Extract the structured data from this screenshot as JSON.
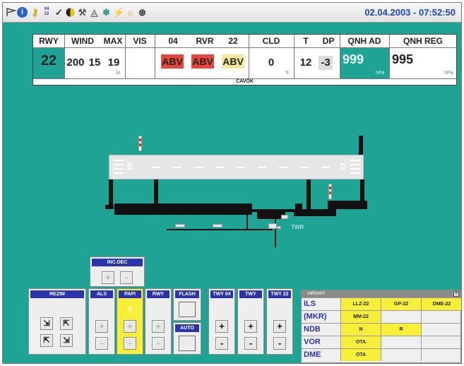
{
  "toolbar": {
    "datetime": "02.04.2003 - 07:52:50",
    "runway_pair_top": "04",
    "runway_pair_bottom": "22"
  },
  "weather": {
    "headers": {
      "rwy": "RWY",
      "wind": "WIND",
      "max": "MAX",
      "vis": "VIS",
      "rwy04": "04",
      "rvr": "RVR",
      "rwy22": "22",
      "cld": "CLD",
      "t": "T",
      "dp": "DP",
      "qnh_ad": "QNH AD",
      "qnh_reg": "QNH REG"
    },
    "rwy": "22",
    "wind_dir": "200",
    "wind_speed": "15",
    "wind_max": "19",
    "wind_unit": "kt",
    "rvr_04": "ABV",
    "rvr_mid": "ABV",
    "rvr_22": "ABV",
    "cld": "0",
    "cld_unit": "ft",
    "temp": "12",
    "dewpoint": "-3",
    "qnh_ad": "999",
    "qnh_ad_unit": "hPa",
    "qnh_reg": "995",
    "qnh_reg_unit": "hPa",
    "cavok": "CAVOK"
  },
  "map": {
    "rwy_num_left": "04",
    "rwy_num_right": "22",
    "twr_label": "TWR"
  },
  "panels": {
    "incdec": {
      "title": "INC.DEC",
      "plus": "+",
      "minus": "-"
    },
    "rezim": {
      "title": "REZIM"
    },
    "als": {
      "title": "ALS",
      "plus": "+",
      "minus": "-"
    },
    "papi": {
      "title": "PAPI",
      "value": "3",
      "plus": "+",
      "minus": "-"
    },
    "rwy": {
      "title": "RWY",
      "plus": "+",
      "minus": "-"
    },
    "flash": {
      "title": "FLASH"
    },
    "auto": {
      "title": "AUTO"
    },
    "twy04": {
      "title": "TWY 04",
      "plus": "+",
      "minus": "-"
    },
    "twy": {
      "title": "TWY",
      "plus": "+",
      "minus": "-"
    },
    "twy22": {
      "title": "TWY 22",
      "plus": "+",
      "minus": "-"
    }
  },
  "equipment": {
    "title": "zařízení",
    "rows": [
      {
        "label": "ILS",
        "cells": [
          "LLZ-22",
          "GP-22",
          "DME-22"
        ]
      },
      {
        "label": "(MKR)",
        "cells": [
          "MM-22",
          "",
          ""
        ]
      },
      {
        "label": "NDB",
        "cells": [
          "N",
          "R",
          ""
        ]
      },
      {
        "label": "VOR",
        "cells": [
          "OTA",
          "",
          ""
        ]
      },
      {
        "label": "DME",
        "cells": [
          "OTA",
          "",
          ""
        ]
      }
    ]
  },
  "colors": {
    "background": "#1fa394",
    "title_bar": "#2b34a8",
    "status_yellow": "#f7ef3a",
    "alert_red": "#e8463a",
    "abv_yellow": "#f4e79c",
    "date_blue": "#1f46b8"
  }
}
